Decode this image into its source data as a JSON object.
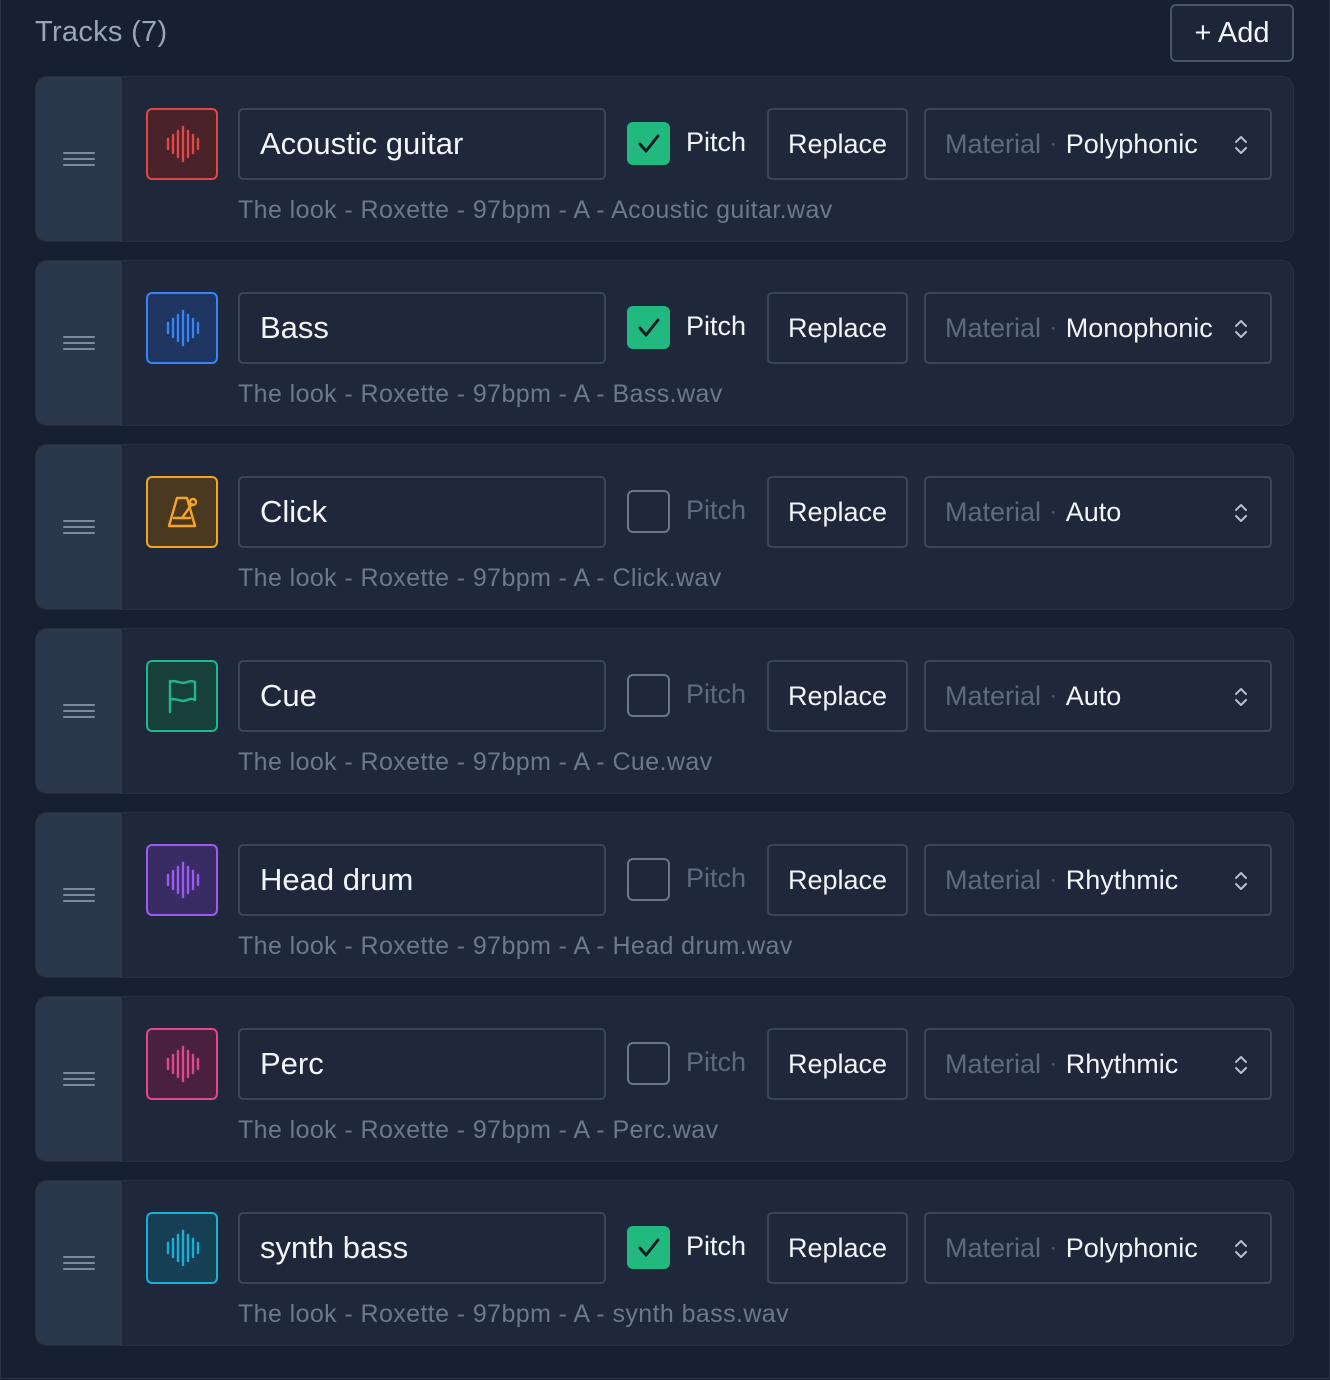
{
  "header": {
    "title": "Tracks (7)",
    "add_label": "+ Add"
  },
  "controls": {
    "pitch_label": "Pitch",
    "replace_label": "Replace",
    "material_label": "Material"
  },
  "colors": {
    "checkbox_on": "#22b981",
    "panel_bg": "#172030"
  },
  "tracks": [
    {
      "name": "Acoustic guitar",
      "pitch": true,
      "material": "Polyphonic",
      "file": "The look - Roxette - 97bpm - A - Acoustic guitar.wav",
      "icon": "waveform-icon",
      "color": "#e04848",
      "bg": "#4a2229"
    },
    {
      "name": "Bass",
      "pitch": true,
      "material": "Monophonic",
      "file": "The look - Roxette - 97bpm - A - Bass.wav",
      "icon": "waveform-icon",
      "color": "#3b82f6",
      "bg": "#1d3560"
    },
    {
      "name": "Click",
      "pitch": false,
      "material": "Auto",
      "file": "The look - Roxette - 97bpm - A - Click.wav",
      "icon": "metronome-icon",
      "color": "#f5a524",
      "bg": "#4a3820"
    },
    {
      "name": "Cue",
      "pitch": false,
      "material": "Auto",
      "file": "The look - Roxette - 97bpm - A - Cue.wav",
      "icon": "flag-icon",
      "color": "#1fb88a",
      "bg": "#17403a"
    },
    {
      "name": "Head drum",
      "pitch": false,
      "material": "Rhythmic",
      "file": "The look - Roxette - 97bpm - A - Head drum.wav",
      "icon": "waveform-icon",
      "color": "#9a5cf0",
      "bg": "#392c64"
    },
    {
      "name": "Perc",
      "pitch": false,
      "material": "Rhythmic",
      "file": "The look - Roxette - 97bpm - A - Perc.wav",
      "icon": "waveform-icon",
      "color": "#e0488a",
      "bg": "#4a2240"
    },
    {
      "name": "synth bass",
      "pitch": true,
      "material": "Polyphonic",
      "file": "The look - Roxette - 97bpm - A - synth bass.wav",
      "icon": "waveform-icon",
      "color": "#19b0d8",
      "bg": "#173f54"
    }
  ]
}
